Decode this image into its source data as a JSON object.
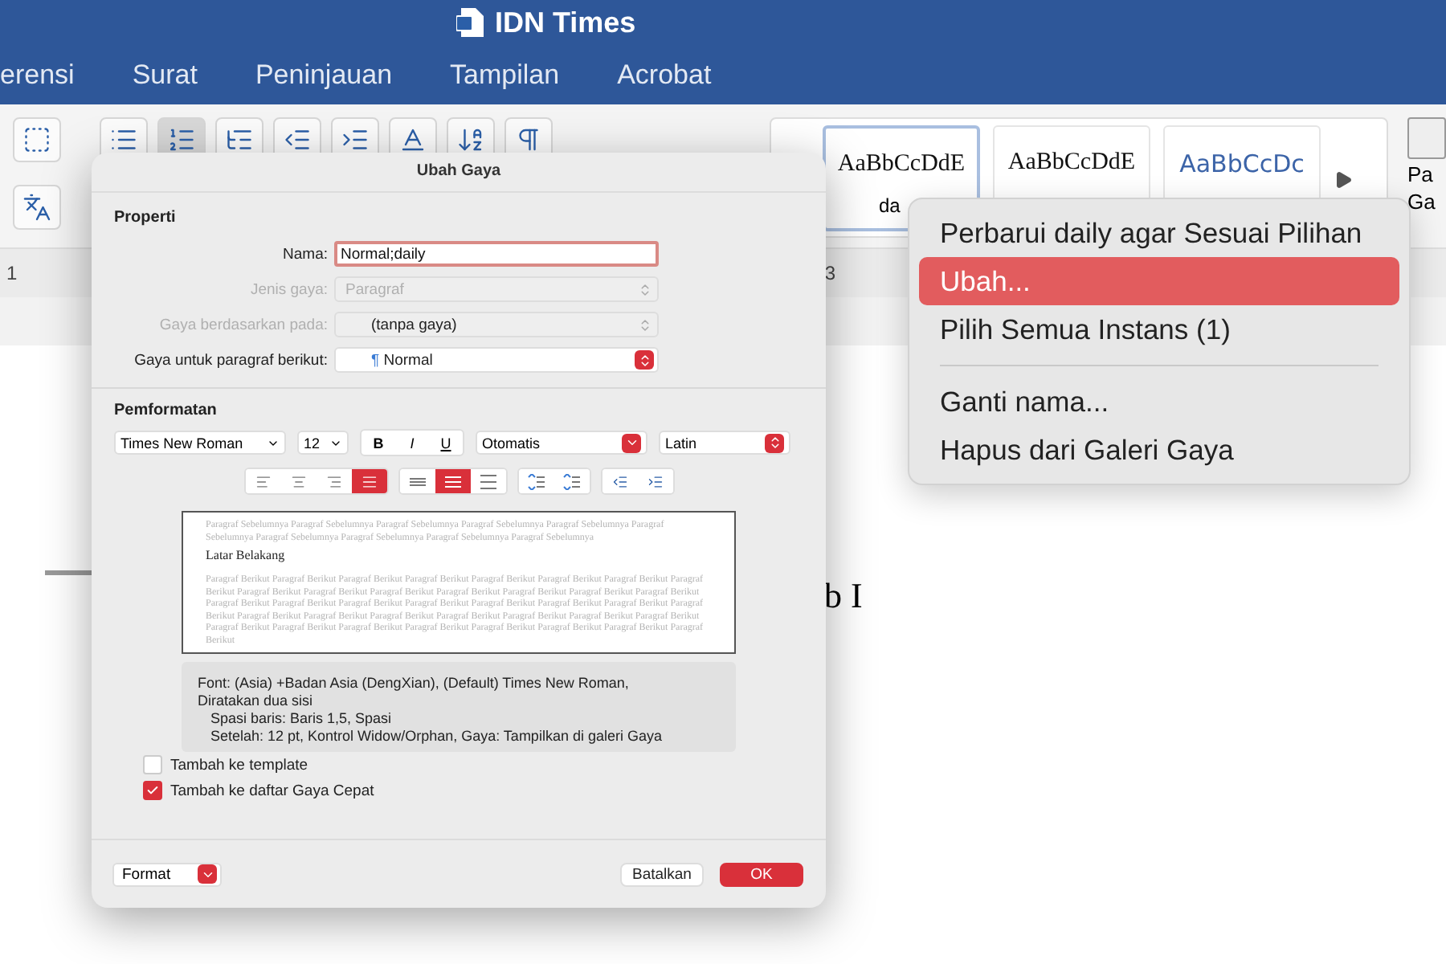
{
  "window": {
    "title": "IDN Times"
  },
  "ribbon_tabs": [
    {
      "label": "erensi"
    },
    {
      "label": "Surat"
    },
    {
      "label": "Peninjauan"
    },
    {
      "label": "Tampilan"
    },
    {
      "label": "Acrobat"
    }
  ],
  "toolbar_left": [
    {
      "kind": "textbox",
      "selected": false
    },
    {
      "kind": "phonetic",
      "selected": false
    }
  ],
  "toolbar_buttons": [
    {
      "kind": "bullets",
      "selected": false
    },
    {
      "kind": "numbering",
      "selected": true
    },
    {
      "kind": "multilevel",
      "selected": false
    },
    {
      "kind": "outdent",
      "selected": false
    },
    {
      "kind": "indent",
      "selected": false
    },
    {
      "kind": "textcolor",
      "selected": false
    },
    {
      "kind": "sort",
      "selected": false
    },
    {
      "kind": "pilcrow",
      "selected": false
    }
  ],
  "style_gallery": {
    "items": [
      {
        "preview": "AaBbCcDdE",
        "label": "da",
        "kind": "serif",
        "selected": true
      },
      {
        "preview": "AaBbCcDdE",
        "kind": "serif",
        "selected": false
      },
      {
        "preview": "AaBbCcDc",
        "kind": "heading",
        "selected": false
      }
    ]
  },
  "styles_pane": {
    "lines": [
      "Pa",
      "Ga"
    ]
  },
  "ruler": {
    "marks": [
      "1",
      "3"
    ]
  },
  "document": {
    "text": "b I"
  },
  "context_menu": {
    "items": [
      {
        "kind": "item",
        "label": "Perbarui daily agar Sesuai Pilihan",
        "selected": false
      },
      {
        "kind": "item",
        "label": "Ubah...",
        "selected": true
      },
      {
        "kind": "item",
        "label": "Pilih Semua Instans (1)",
        "selected": false
      },
      {
        "kind": "separator"
      },
      {
        "kind": "item",
        "label": "Ganti nama...",
        "selected": false
      },
      {
        "kind": "item",
        "label": "Hapus dari Galeri Gaya",
        "selected": false
      }
    ]
  },
  "dialog": {
    "title": "Ubah Gaya",
    "properties": {
      "heading": "Properti",
      "fields": [
        {
          "kind": "text",
          "label": "Nama:",
          "value": "Normal;daily",
          "disabled": false
        },
        {
          "kind": "select",
          "label": "Jenis gaya:",
          "value": "Paragraf",
          "disabled": true
        },
        {
          "kind": "select",
          "label": "Gaya berdasarkan pada:",
          "value": "(tanpa gaya)",
          "disabled": true
        },
        {
          "kind": "select",
          "label": "Gaya untuk paragraf berikut:",
          "prefix": "¶",
          "value": "Normal",
          "disabled": false
        }
      ]
    },
    "formatting": {
      "heading": "Pemformatan",
      "font": "Times New Roman",
      "size": "12",
      "styles": [
        {
          "label": "B",
          "kind": "bold",
          "selected": false
        },
        {
          "label": "I",
          "kind": "italic",
          "selected": false
        },
        {
          "label": "U",
          "kind": "underline",
          "selected": false
        }
      ],
      "color_option": "Otomatis",
      "script": "Latin",
      "button_groups": [
        [
          {
            "kind": "align-left",
            "selected": false
          },
          {
            "kind": "align-center",
            "selected": false
          },
          {
            "kind": "align-right",
            "selected": false
          },
          {
            "kind": "align-justify",
            "selected": true
          }
        ],
        [
          {
            "kind": "spacing-single",
            "selected": false
          },
          {
            "kind": "spacing-half",
            "selected": true
          },
          {
            "kind": "spacing-double",
            "selected": false
          }
        ],
        [
          {
            "kind": "space-before",
            "selected": false
          },
          {
            "kind": "space-after",
            "selected": false
          }
        ],
        [
          {
            "kind": "outdent",
            "selected": false
          },
          {
            "kind": "indent",
            "selected": false
          }
        ]
      ]
    },
    "preview": {
      "before": "Paragraf Sebelumnya Paragraf Sebelumnya Paragraf Sebelumnya Paragraf Sebelumnya Paragraf Sebelumnya Paragraf Sebelumnya Paragraf Sebelumnya Paragraf Sebelumnya Paragraf Sebelumnya Paragraf Sebelumnya",
      "sample": "Latar Belakang",
      "after": "Paragraf Berikut Paragraf Berikut Paragraf Berikut Paragraf Berikut Paragraf Berikut Paragraf Berikut Paragraf Berikut Paragraf Berikut Paragraf Berikut Paragraf Berikut Paragraf Berikut Paragraf Berikut Paragraf Berikut Paragraf Berikut Paragraf Berikut Paragraf Berikut Paragraf Berikut Paragraf Berikut Paragraf Berikut Paragraf Berikut Paragraf Berikut Paragraf Berikut Paragraf Berikut Paragraf Berikut Paragraf Berikut Paragraf Berikut Paragraf Berikut Paragraf Berikut Paragraf Berikut Paragraf Berikut Paragraf Berikut Paragraf Berikut Paragraf Berikut Paragraf Berikut Paragraf Berikut Paragraf Berikut Paragraf Berikut Paragraf Berikut"
    },
    "description": [
      "Font: (Asia) +Badan Asia (DengXian), (Default) Times New Roman, Diratakan dua sisi",
      "Spasi baris:  Baris 1,5, Spasi",
      "Setelah:  12 pt, Kontrol Widow/Orphan, Gaya: Tampilkan di galeri Gaya"
    ],
    "checkboxes": [
      {
        "label": "Tambah ke template",
        "checked": false
      },
      {
        "label": "Tambah ke daftar Gaya Cepat",
        "checked": true
      }
    ],
    "format_menu": "Format",
    "buttons": [
      {
        "label": "Batalkan",
        "kind": "secondary"
      },
      {
        "label": "OK",
        "kind": "primary"
      }
    ]
  }
}
